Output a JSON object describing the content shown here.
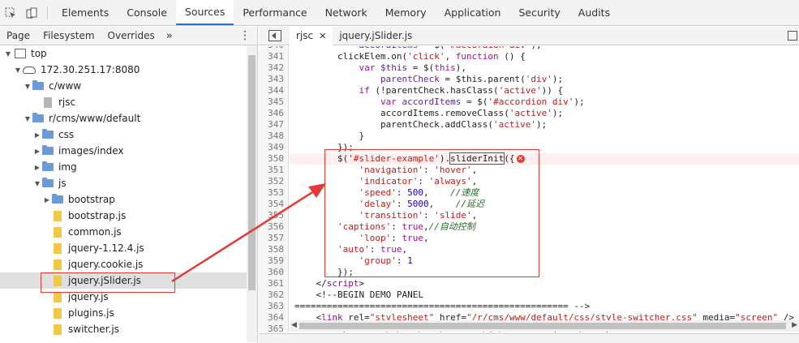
{
  "topbar": {
    "tabs": [
      {
        "label": "Elements"
      },
      {
        "label": "Console"
      },
      {
        "label": "Sources",
        "active": true
      },
      {
        "label": "Performance"
      },
      {
        "label": "Network"
      },
      {
        "label": "Memory"
      },
      {
        "label": "Application"
      },
      {
        "label": "Security"
      },
      {
        "label": "Audits"
      }
    ],
    "active_color": "#1a73e8"
  },
  "navigator": {
    "tabs": [
      "Page",
      "Filesystem",
      "Overrides"
    ],
    "more": "»",
    "tree": [
      {
        "label": "top",
        "icon": "frame-icon",
        "open": true,
        "depth": 0
      },
      {
        "label": "172.30.251.17:8080",
        "icon": "cloud-icon",
        "open": true,
        "depth": 1
      },
      {
        "label": "c/www",
        "icon": "folder-icon",
        "open": true,
        "depth": 2
      },
      {
        "label": "rjsc",
        "icon": "file-icon",
        "depth": 3
      },
      {
        "label": "r/cms/www/default",
        "icon": "folder-icon",
        "open": true,
        "depth": 2
      },
      {
        "label": "css",
        "icon": "folder-icon",
        "open": false,
        "depth": 3
      },
      {
        "label": "images/index",
        "icon": "folder-icon",
        "open": false,
        "depth": 3
      },
      {
        "label": "img",
        "icon": "folder-icon",
        "open": false,
        "depth": 3
      },
      {
        "label": "js",
        "icon": "folder-icon",
        "open": true,
        "depth": 3
      },
      {
        "label": "bootstrap",
        "icon": "folder-icon",
        "open": false,
        "depth": 4
      },
      {
        "label": "bootstrap.js",
        "icon": "js-file-icon",
        "depth": 4
      },
      {
        "label": "common.js",
        "icon": "js-file-icon",
        "depth": 4
      },
      {
        "label": "jquery-1.12.4.js",
        "icon": "js-file-icon",
        "depth": 4
      },
      {
        "label": "jquery.cookie.js",
        "icon": "js-file-icon",
        "depth": 4
      },
      {
        "label": "jquery.jSlider.js",
        "icon": "js-file-icon",
        "depth": 4,
        "selected": true
      },
      {
        "label": "jquery.js",
        "icon": "js-file-icon",
        "depth": 4
      },
      {
        "label": "plugins.js",
        "icon": "js-file-icon",
        "depth": 4
      },
      {
        "label": "switcher.js",
        "icon": "js-file-icon",
        "depth": 4
      }
    ]
  },
  "editor": {
    "tabs": [
      {
        "label": "rjsc",
        "closable": true,
        "active": true
      },
      {
        "label": "jquery.jSlider.js"
      }
    ],
    "lines": [
      {
        "no": "340",
        "html": "            <span class=\"v\">accordItems</span> = $(<span class=\"s\">'#accordion div'</span>);"
      },
      {
        "no": "341",
        "html": "        clickElem.on(<span class=\"s\">'click'</span>, <span class=\"k\">function</span> () {"
      },
      {
        "no": "342",
        "html": "            <span class=\"k\">var</span> <span class=\"v\">$this</span> = $(<span class=\"k\">this</span>),"
      },
      {
        "no": "343",
        "html": "                <span class=\"v\">parentCheck</span> = $this.parent(<span class=\"s\">'div'</span>);"
      },
      {
        "no": "344",
        "html": "            <span class=\"k\">if</span> (!parentCheck.hasClass(<span class=\"s\">'active'</span>)) {"
      },
      {
        "no": "345",
        "html": "                <span class=\"k\">var</span> <span class=\"v\">accordItems</span> = $(<span class=\"s\">'#accordion div'</span>);"
      },
      {
        "no": "346",
        "html": "                accordItems.removeClass(<span class=\"s\">'active'</span>);"
      },
      {
        "no": "347",
        "html": "                parentCheck.addClass(<span class=\"s\">'active'</span>);"
      },
      {
        "no": "348",
        "html": "            }"
      },
      {
        "no": "349",
        "html": "        });"
      },
      {
        "no": "350",
        "html": "        $(<span class=\"s\">'#slider-example'</span>).<span class=\"token-box\">sliderInit</span>({<span class=\"err\">✕</span>",
        "error": true
      },
      {
        "no": "351",
        "html": "            <span class=\"s\">'navigation'</span>: <span class=\"s\">'hover'</span>,"
      },
      {
        "no": "352",
        "html": "            <span class=\"s\">'indicator'</span>: <span class=\"s\">'always'</span>,"
      },
      {
        "no": "353",
        "html": "            <span class=\"s\">'speed'</span>: <span class=\"n\">500</span>,    <span class=\"c\">//速度</span>"
      },
      {
        "no": "354",
        "html": "            <span class=\"s\">'delay'</span>: <span class=\"n\">5000</span>,    <span class=\"c\">//延迟</span>"
      },
      {
        "no": "355",
        "html": "            <span class=\"s\">'transition'</span>: <span class=\"s\">'slide'</span>,"
      },
      {
        "no": "356",
        "html": "        <span class=\"s\">'captions'</span>: <span class=\"k\">true</span>,<span class=\"c\">//自动控制</span>"
      },
      {
        "no": "357",
        "html": "            <span class=\"s\">'loop'</span>: <span class=\"k\">true</span>,"
      },
      {
        "no": "358",
        "html": "        <span class=\"s\">'auto'</span>: <span class=\"k\">true</span>,"
      },
      {
        "no": "359",
        "html": "            <span class=\"s\">'group'</span>: <span class=\"n\">1</span>"
      },
      {
        "no": "360",
        "html": "        });"
      },
      {
        "no": "361",
        "html": "    &lt;/<span class=\"t\">script</span>&gt;"
      },
      {
        "no": "362",
        "html": "    &lt;!--BEGIN DEMO PANEL"
      },
      {
        "no": "363",
        "html": "=================================================== --&gt;"
      },
      {
        "no": "364",
        "html": "    &lt;<span class=\"t\">link</span> rel=<span class=\"s\">\"stylesheet\"</span> href=<span class=\"s\">\"/r/cms/www/default/css/style-switcher.css\"</span> media=<span class=\"s\">\"screen\"</span> /&gt;"
      },
      {
        "no": "365",
        "html": "    &lt;<span class=\"t\">script</span> src=<span class=\"s\">\"/r/cms/www/default/js/switcher.js\"</span>&gt;&lt;/<span class=\"t\">script</span>&gt;"
      }
    ]
  },
  "annotation": {
    "color": "#e53935"
  }
}
